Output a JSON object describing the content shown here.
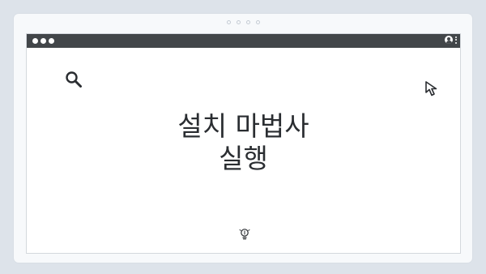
{
  "headline": {
    "line1": "설치 마법사",
    "line2": "실행"
  },
  "pager": {
    "count": 4
  },
  "icons": {
    "search": "search-icon",
    "cursor": "cursor-icon",
    "user": "user-icon",
    "menu": "kebab-menu-icon",
    "bottom": "lightbulb-icon"
  },
  "colors": {
    "titlebar": "#424649",
    "background": "#dde3ea",
    "card": "#f7f9fb",
    "text": "#2a2d31"
  }
}
